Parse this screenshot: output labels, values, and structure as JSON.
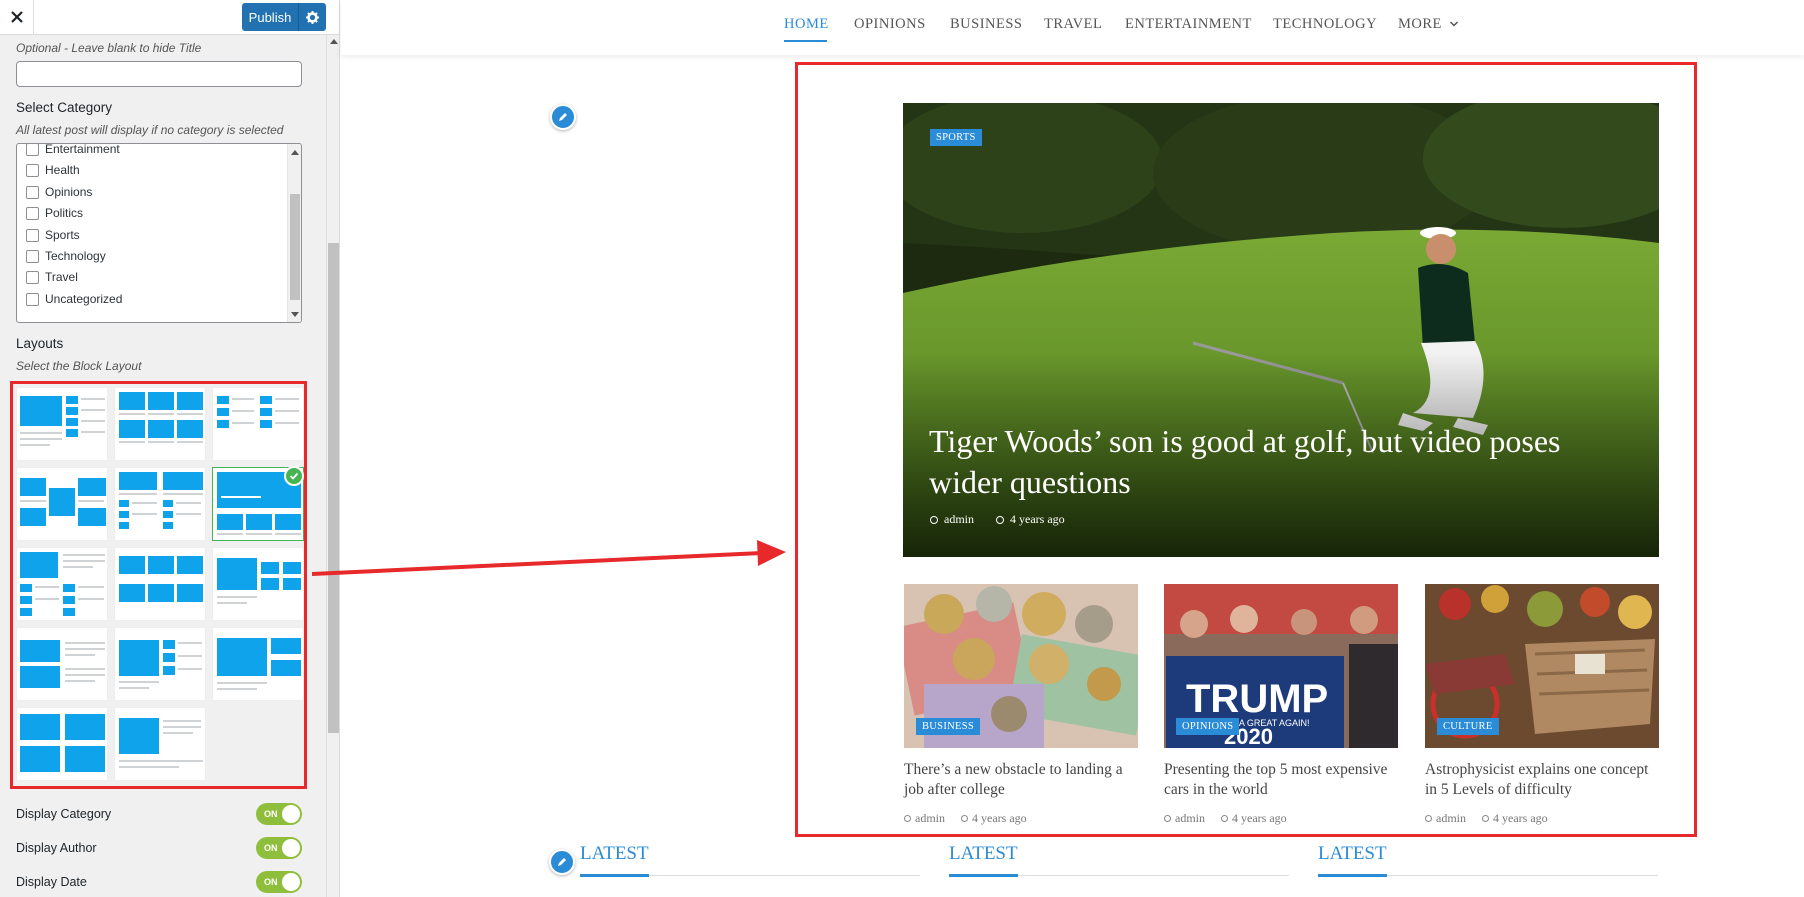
{
  "topbar": {
    "close_icon": "close-icon",
    "publish_label": "Publish",
    "settings_icon": "gear-icon"
  },
  "sidebar": {
    "title_hint": "Optional - Leave blank to hide Title",
    "title_value": "",
    "select_category_label": "Select Category",
    "select_category_hint": "All latest post will display if no category is selected",
    "categories": [
      "Entertainment",
      "Health",
      "Opinions",
      "Politics",
      "Sports",
      "Technology",
      "Travel",
      "Uncategorized"
    ],
    "layouts_label": "Layouts",
    "layouts_hint": "Select the Block Layout",
    "selected_layout": 6,
    "toggles": [
      {
        "label": "Display Category",
        "state": "ON"
      },
      {
        "label": "Display Author",
        "state": "ON"
      },
      {
        "label": "Display Date",
        "state": "ON"
      }
    ]
  },
  "nav": {
    "items": [
      "HOME",
      "OPINIONS",
      "BUSINESS",
      "TRAVEL",
      "ENTERTAINMENT",
      "TECHNOLOGY",
      "MORE"
    ],
    "active": "HOME"
  },
  "hero": {
    "category": "SPORTS",
    "title": "Tiger Woods’ son is good at golf, but video poses wider questions",
    "author": "admin",
    "date": "4 years ago"
  },
  "cards": [
    {
      "category": "BUSINESS",
      "title": "There’s a new obstacle to landing a job after college",
      "author": "admin",
      "date": "4 years ago"
    },
    {
      "category": "OPINIONS",
      "title": "Presenting the top 5 most expensive cars in the world",
      "author": "admin",
      "date": "4 years ago",
      "image_text": "TRUMP",
      "image_subtext": "KEEP AMERICA GREAT AGAIN!",
      "image_year": "2020"
    },
    {
      "category": "CULTURE",
      "title": "Astrophysicist explains one concept in 5 Levels of difficulty",
      "author": "admin",
      "date": "4 years ago"
    }
  ],
  "latest_headings": [
    "LATEST",
    "LATEST",
    "LATEST"
  ],
  "colors": {
    "accent": "#2a8bd6",
    "publish": "#2271b1",
    "highlight": "#e8292b",
    "toggle_on": "#8fbe3c",
    "layout_block": "#0ea3ea"
  }
}
